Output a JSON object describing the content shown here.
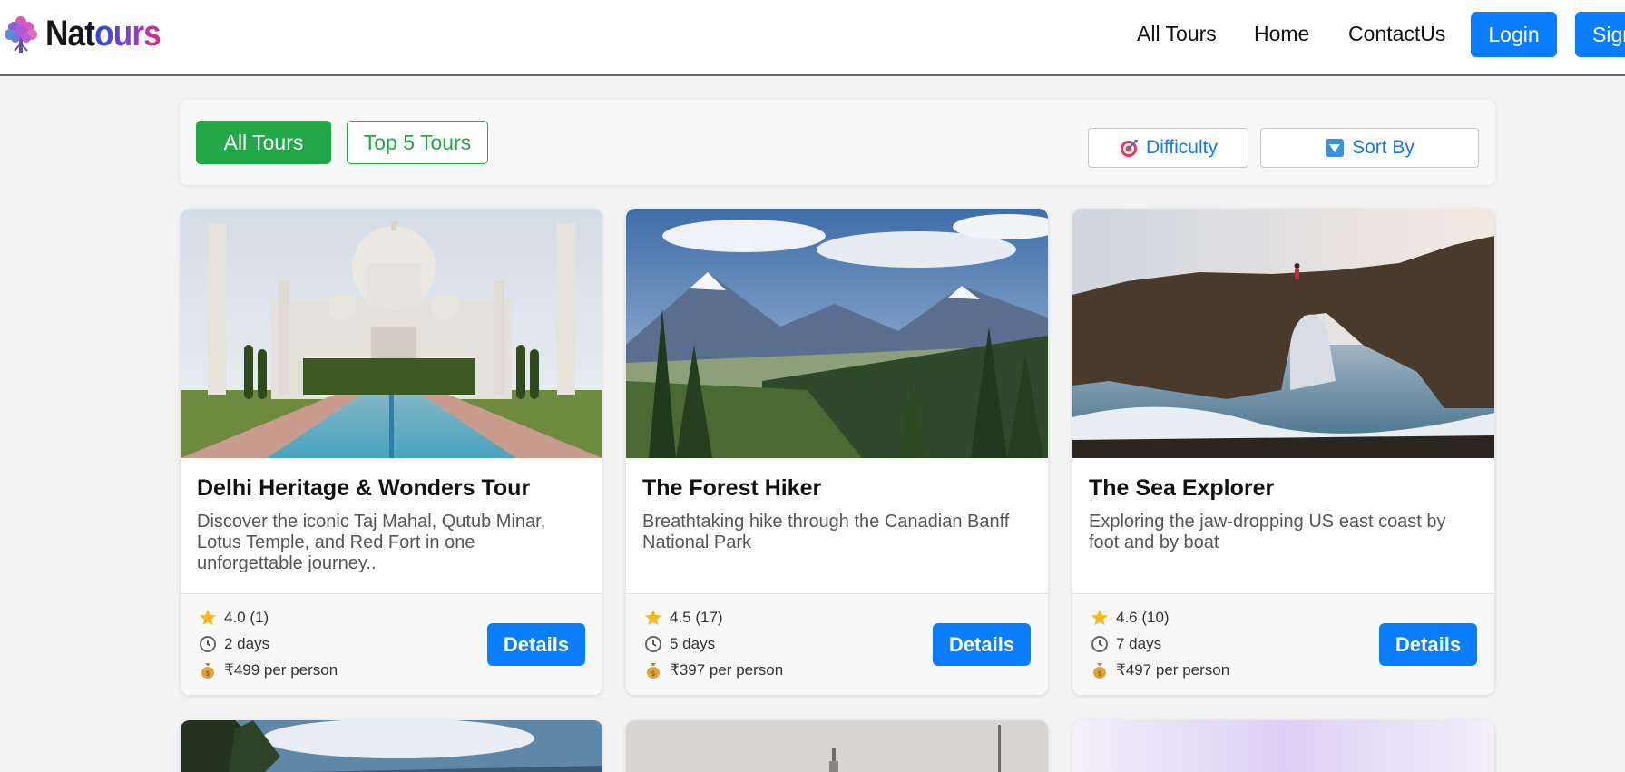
{
  "brand": {
    "name_part1": "Nat",
    "name_part2": "ours"
  },
  "nav": {
    "links": [
      "All Tours",
      "Home",
      "ContactUs"
    ],
    "login_label": "Login",
    "signup_label": "Sign"
  },
  "filters": {
    "tabs": [
      "All Tours",
      "Top 5 Tours"
    ],
    "active_tab": "All Tours",
    "difficulty_label": "Difficulty",
    "sort_label": "Sort By"
  },
  "tours": [
    {
      "title": "Delhi Heritage & Wonders Tour",
      "description": "Discover the iconic Taj Mahal, Qutub Minar, Lotus Temple, and Red Fort in one unforgettable journey..",
      "rating": "4.0 (1)",
      "duration": "2 days",
      "price": "₹499 per person",
      "button": "Details",
      "image": "taj-mahal-photo"
    },
    {
      "title": "The Forest Hiker",
      "description": "Breathtaking hike through the Canadian Banff National Park",
      "rating": "4.5 (17)",
      "duration": "5 days",
      "price": "₹397 per person",
      "button": "Details",
      "image": "mountain-forest-photo"
    },
    {
      "title": "The Sea Explorer",
      "description": "Exploring the jaw-dropping US east coast by foot and by boat",
      "rating": "4.6 (10)",
      "duration": "7 days",
      "price": "₹497 per person",
      "button": "Details",
      "image": "sea-arch-photo"
    }
  ],
  "colors": {
    "primary": "#0a7dfc",
    "success": "#22a849",
    "background": "#f3f3f3"
  }
}
